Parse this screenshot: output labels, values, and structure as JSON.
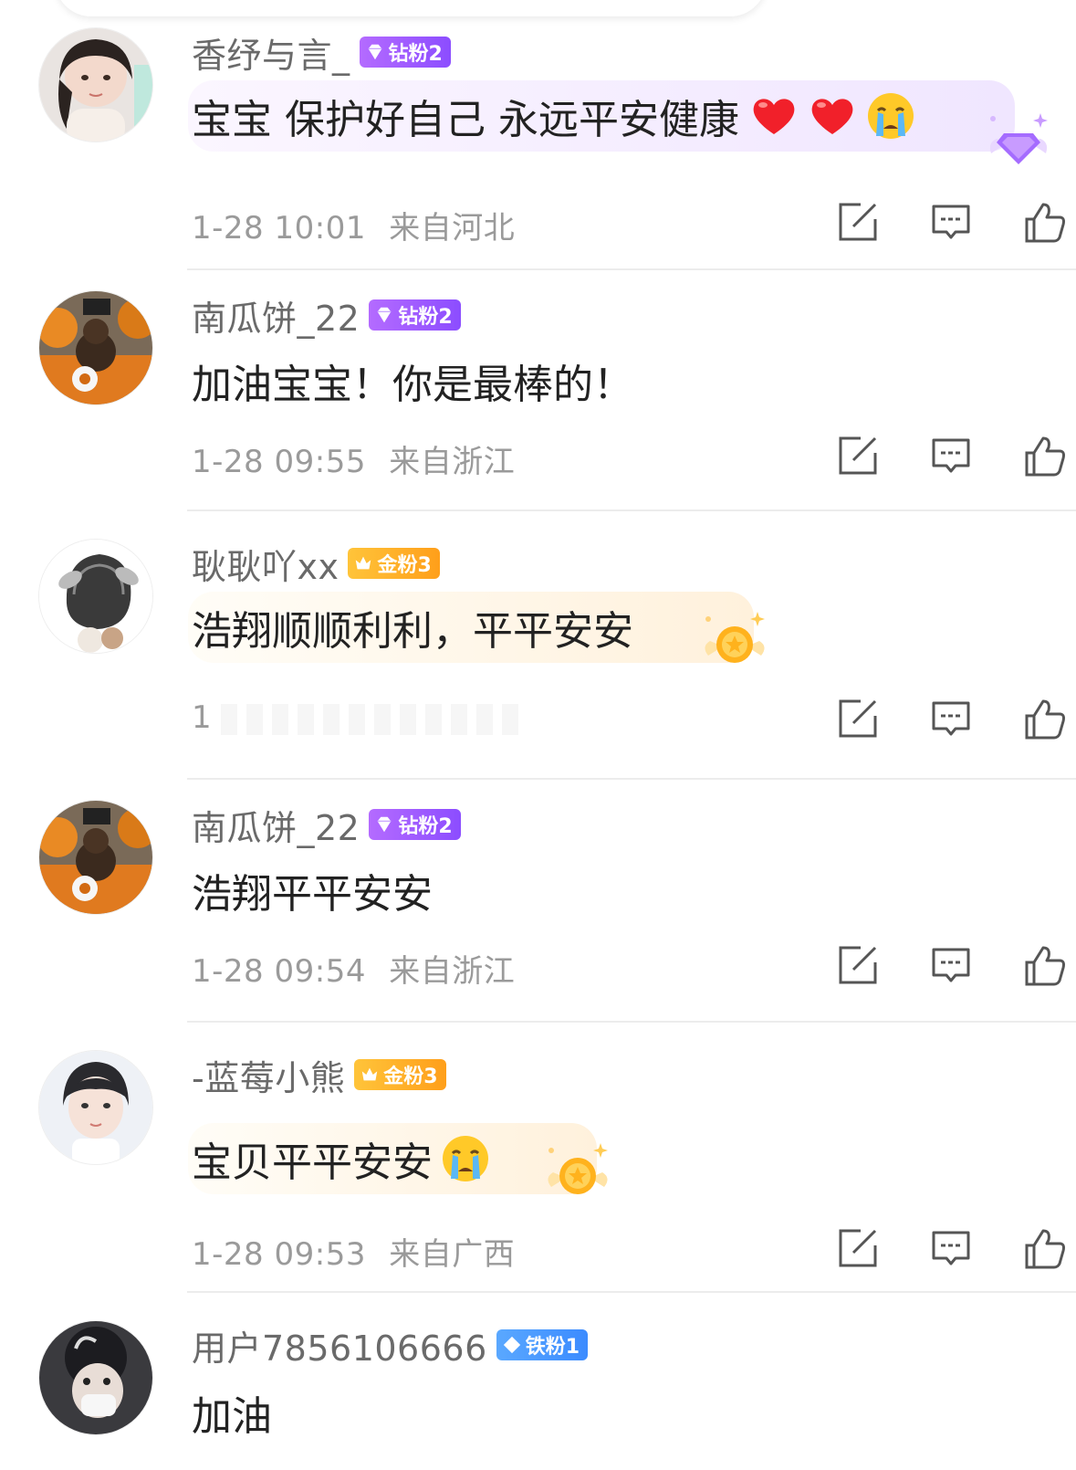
{
  "comments": [
    {
      "username": "香纾与言_",
      "badge": {
        "type": "diamond",
        "label": "钻粉2"
      },
      "text": "宝宝 保护好自己 永远平安健康",
      "emojis": [
        "heart",
        "heart",
        "crying"
      ],
      "time": "1-28 10:01",
      "location": "来自河北",
      "bubble": "purple"
    },
    {
      "username": "南瓜饼_22",
      "badge": {
        "type": "diamond",
        "label": "钻粉2"
      },
      "text": "加油宝宝！你是最棒的！",
      "time": "1-28 09:55",
      "location": "来自浙江"
    },
    {
      "username": "耿耿吖xx",
      "badge": {
        "type": "gold",
        "label": "金粉3"
      },
      "text": "浩翔顺顺利利，平平安安",
      "time": "1",
      "bubble": "gold"
    },
    {
      "username": "南瓜饼_22",
      "badge": {
        "type": "diamond",
        "label": "钻粉2"
      },
      "text": "浩翔平平安安",
      "time": "1-28 09:54",
      "location": "来自浙江"
    },
    {
      "username": "-蓝莓小熊",
      "badge": {
        "type": "gold",
        "label": "金粉3"
      },
      "text": "宝贝平平安安",
      "emojis": [
        "crying"
      ],
      "time": "1-28 09:53",
      "location": "来自广西",
      "bubble": "gold"
    },
    {
      "username": "用户7856106666",
      "badge": {
        "type": "iron",
        "label": "铁粉1"
      },
      "text": "加油"
    }
  ],
  "icons": {
    "edit": "edit-icon",
    "reply": "comment-icon",
    "like": "thumbs-up-icon"
  },
  "colors": {
    "diamond_badge": "#9b5cff",
    "gold_badge": "#ffb020",
    "iron_badge": "#4596ff",
    "meta_text": "#9a9a9a",
    "body_text": "#222222"
  }
}
